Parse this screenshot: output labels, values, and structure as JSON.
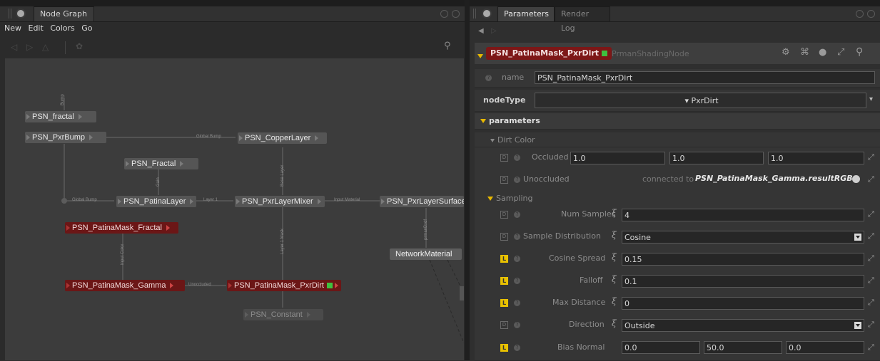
{
  "left_pane": {
    "tab_title": "Node Graph",
    "menu": [
      "New",
      "Edit",
      "Colors",
      "Go"
    ],
    "nodes": {
      "psn_fractal": "PSN_fractal",
      "psn_pxrbump": "PSN_PxrBump",
      "psn_copperlayer": "PSN_CopperLayer",
      "psn_fractal2": "PSN_Fractal",
      "psn_patinalayer": "PSN_PatinaLayer",
      "psn_pxrlayermixer": "PSN_PxrLayerMixer",
      "psn_pxrlayersurface": "PSN_PxrLayerSurface",
      "psn_patinamask_fractal": "PSN_PatinaMask_Fractal",
      "network_material": "NetworkMaterial",
      "psn_patinamask_gamma": "PSN_PatinaMask_Gamma",
      "psn_patinamask_pxrdirt": "PSN_PatinaMask_PxrDirt",
      "psn_constant": "PSN_Constant"
    },
    "edge_labels": {
      "bump": "Bump",
      "global_bump_1": "Global Bump",
      "global_bump_2": "Global Bump",
      "gain": "Gain",
      "base_layer": "Base Layer",
      "layer_1": "Layer 1",
      "input_material": "Input Material",
      "prman_bxdf": "prmanBxdf",
      "layer_1_mask": "Layer 1 Mask",
      "input_color": "Input Color",
      "unoccluded": "Unoccluded"
    }
  },
  "right_pane": {
    "tabs": [
      "Parameters",
      "Render Log"
    ],
    "node_name": "PSN_PatinaMask_PxrDirt",
    "node_type_label": "PrmanShadingNode",
    "name_label": "name",
    "name_value": "PSN_PatinaMask_PxrDirt",
    "nodetype_label": "nodeType",
    "nodetype_value": "PxrDirt",
    "parameters_label": "parameters",
    "dirt_color_label": "Dirt Color",
    "occluded": {
      "label": "Occluded",
      "values": [
        "1.0",
        "1.0",
        "1.0"
      ]
    },
    "unoccluded": {
      "label": "Unoccluded",
      "prefix": "connected to",
      "connection": "PSN_PatinaMask_Gamma.resultRGB"
    },
    "sampling_label": "Sampling",
    "num_samples": {
      "label": "Num Samples",
      "value": "4"
    },
    "sample_distribution": {
      "label": "Sample Distribution",
      "value": "Cosine"
    },
    "cosine_spread": {
      "label": "Cosine Spread",
      "value": "0.15"
    },
    "falloff": {
      "label": "Falloff",
      "value": "0.1"
    },
    "max_distance": {
      "label": "Max Distance",
      "value": "0"
    },
    "direction": {
      "label": "Direction",
      "value": "Outside"
    },
    "bias_normal": {
      "label": "Bias Normal",
      "values": [
        "0.0",
        "50.0",
        "0.0"
      ]
    },
    "colors": {
      "node_red": "#7d1717",
      "link_yellow": "#e8c100",
      "bg": "#2f2f2f"
    }
  }
}
